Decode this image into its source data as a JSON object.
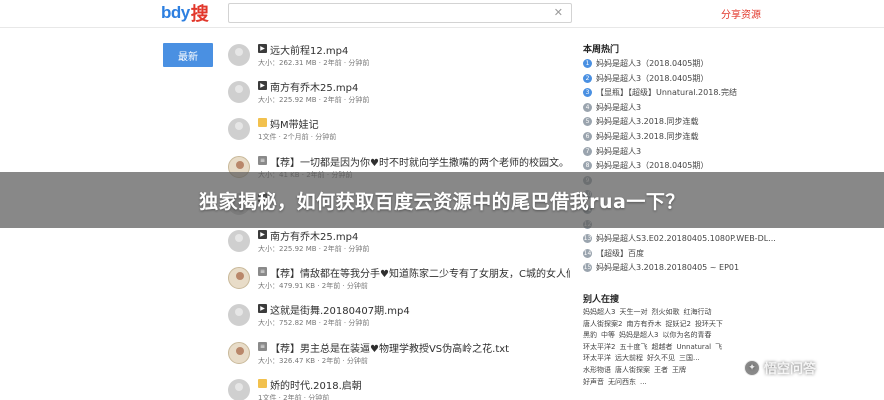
{
  "header": {
    "logo_part1": "bdy",
    "logo_part2": "搜",
    "search_value": "",
    "clear_glyph": "✕",
    "share_label": "分享资源"
  },
  "nav": {
    "latest_label": "最新"
  },
  "files": [
    {
      "type": "video",
      "icon": "video-icon",
      "thumb": "plain",
      "name": "远大前程12.mp4",
      "meta": "大小：262.31 MB · 2年前 · 分钟前"
    },
    {
      "type": "video",
      "icon": "video-icon",
      "thumb": "plain",
      "name": "南方有乔木25.mp4",
      "meta": "大小：225.92 MB · 2年前 · 分钟前"
    },
    {
      "type": "folder",
      "icon": "folder-icon",
      "thumb": "plain",
      "name": "妈M带娃记",
      "meta": "1文件 · 2个月前 · 分钟前"
    },
    {
      "type": "txt",
      "icon": "text-file-icon",
      "thumb": "avatar",
      "name": "【荐】一切都是因为你♥时不时就向学生撒嘴的两个老师的校园文。.txt",
      "meta": "大小：41 KB · 2年前 · 分钟前"
    },
    {
      "type": "video",
      "icon": "video-icon",
      "thumb": "plain",
      "name": "",
      "meta": ""
    },
    {
      "type": "video",
      "icon": "video-icon",
      "thumb": "plain",
      "name": "南方有乔木25.mp4",
      "meta": "大小：225.92 MB · 2年前 · 分钟前"
    },
    {
      "type": "txt",
      "icon": "text-file-icon",
      "thumb": "avatar",
      "name": "【荐】情敌都在等我分手♥知道陈家二少专有了女朋友，C城的女人们都...",
      "meta": "大小：479.91 KB · 2年前 · 分钟前"
    },
    {
      "type": "video",
      "icon": "video-icon",
      "thumb": "plain",
      "name": "这就是街舞.20180407期.mp4",
      "meta": "大小：752.82 MB · 2年前 · 分钟前"
    },
    {
      "type": "txt",
      "icon": "text-file-icon",
      "thumb": "avatar",
      "name": "【荐】男主总是在装逼♥物理学教授VS伪高岭之花.txt",
      "meta": "大小：326.47 KB · 2年前 · 分钟前"
    },
    {
      "type": "folder",
      "icon": "folder-icon",
      "thumb": "plain",
      "name": "娇的时代.2018.启朝",
      "meta": "1文件 · 2年前 · 分钟前"
    }
  ],
  "sidebar": {
    "hot_title": "本周热门",
    "hot_items": [
      "妈妈是超人3（2018.0405期）",
      "妈妈是超人3（2018.0405期）",
      "【显瓶】【超级】Unnatural.2018.完结",
      "妈妈是超人3",
      "妈妈是超人3.2018.同步连载",
      "妈妈是超人3.2018.同步连载",
      "妈妈是超人3",
      "妈妈是超人3（2018.0405期）",
      "",
      "",
      "",
      "",
      "妈妈是超人S3.E02.20180405.1080P.WEB-DL...",
      "【超级】百度",
      "妈妈是超人3.2018.20180405 ~ EP01"
    ],
    "people_title": "别人在搜",
    "people_rows": [
      [
        "妈妈超人3",
        "天生一对",
        "烈火如歌",
        "红海行动"
      ],
      [
        "唐人街探案2",
        "南方有乔木",
        "捉妖记2",
        "投环天下"
      ],
      [
        "黑豹",
        "中等",
        "妈妈是超人3",
        "以你为名的青春"
      ],
      [
        "环太平洋2",
        "五十度飞",
        "超越者",
        "Unnatural",
        "飞"
      ],
      [
        "环太平洋",
        "远大前程",
        "好久不见",
        "三国..."
      ],
      [
        "水形物语",
        "唐人街探案",
        "王者",
        "王牌"
      ],
      [
        "好声音",
        "无问西东",
        "..."
      ]
    ]
  },
  "banner": {
    "title": "独家揭秘，如何获取百度云资源中的尾巴借我rua一下？"
  },
  "watermark": {
    "text": "悟空问答",
    "logo_glyph": "✦"
  }
}
